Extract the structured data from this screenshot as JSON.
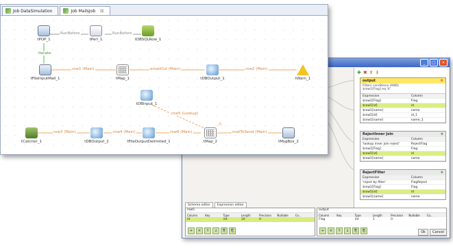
{
  "editor": {
    "tabs": [
      {
        "label": "Job DataSimulation"
      },
      {
        "label": "Job MailsJob"
      }
    ],
    "close_glyph": "☒"
  },
  "components": {
    "tpop": "tPOP_1",
    "tperl": "tPerl_1",
    "tdbsqlrow": "tDBSQLRow_1",
    "tfileinput": "tFileInputMail_1",
    "tmap1": "tMap_1",
    "tdboutput1": "tDBOutput_1",
    "twarn": "tWarn_1",
    "tdbinput": "tDBInput_1",
    "tcatcher": "tCatcher_1",
    "tdboutput2": "tDBOutput_2",
    "tfileoutput": "tFileOutputDelimited_1",
    "tmap2": "tMap_2",
    "tmsgbox": "tMsgBox_2"
  },
  "links": {
    "runbefore1": "RunBefore",
    "runbefore2": "RunBefore",
    "iterate": "Iterate",
    "row1": "row1 (Main)",
    "emailout": "emailOut (Main)",
    "row2": "row2 (Main)",
    "row5": "row5 (Lookup)",
    "row3": "row3 (Main)",
    "row4": "row4 (Main)",
    "row6": "row6 (Main)",
    "mail": "mailToSend (Main)"
  },
  "mapper": {
    "output": {
      "title": "output",
      "filter_label": "Filters conditions (AND)",
      "filter_value": "$row1[Flag] eq 'X'",
      "col_expr": "Expression",
      "col_column": "Column",
      "rows": [
        {
          "expr": "$row1[Flag]",
          "col": "Flag"
        },
        {
          "expr": "$row5[id]",
          "col": "id"
        },
        {
          "expr": "$row1[name]",
          "col": "name"
        },
        {
          "expr": "$row5[id]",
          "col": "id_1"
        },
        {
          "expr": "$row1[name]",
          "col": "name_1"
        }
      ]
    },
    "box2": {
      "title": "RejectInner Join",
      "col_expr": "Expression",
      "col_column": "Column",
      "rows": [
        {
          "expr": "'lookup inner join reject'",
          "col": "RejectFlag"
        },
        {
          "expr": "$row1[Flag]",
          "col": "Flag"
        },
        {
          "expr": "$row5[id]",
          "col": "id"
        },
        {
          "expr": "$row1[name]",
          "col": "name"
        }
      ]
    },
    "box3": {
      "title": "RejectFilter",
      "col_expr": "Expression",
      "col_column": "Column",
      "rows": [
        {
          "expr": "'reject by filter'",
          "col": "FlagReject"
        },
        {
          "expr": "$row1[Flag]",
          "col": "Flag"
        },
        {
          "expr": "$row5[id]",
          "col": "id"
        },
        {
          "expr": "$row1[name]",
          "col": "name"
        }
      ]
    },
    "tabs": [
      "Schema editor",
      "Expression editor"
    ],
    "schema_left": {
      "caption": "row5",
      "headers": [
        "Column",
        "Key",
        "Type",
        "Length",
        "Precision",
        "Nullable",
        "Co..."
      ],
      "row": [
        "id",
        "",
        "int",
        "10",
        "0",
        "",
        ""
      ]
    },
    "schema_right": {
      "caption": "output",
      "headers": [
        "Column",
        "Key",
        "Type",
        "Length",
        "Precision",
        "Nullable",
        "Co..."
      ],
      "row": [
        "Flag",
        "",
        "int",
        "1",
        "0",
        "",
        ""
      ]
    },
    "ok_label": "Ok",
    "cancel_label": "Cancel"
  }
}
